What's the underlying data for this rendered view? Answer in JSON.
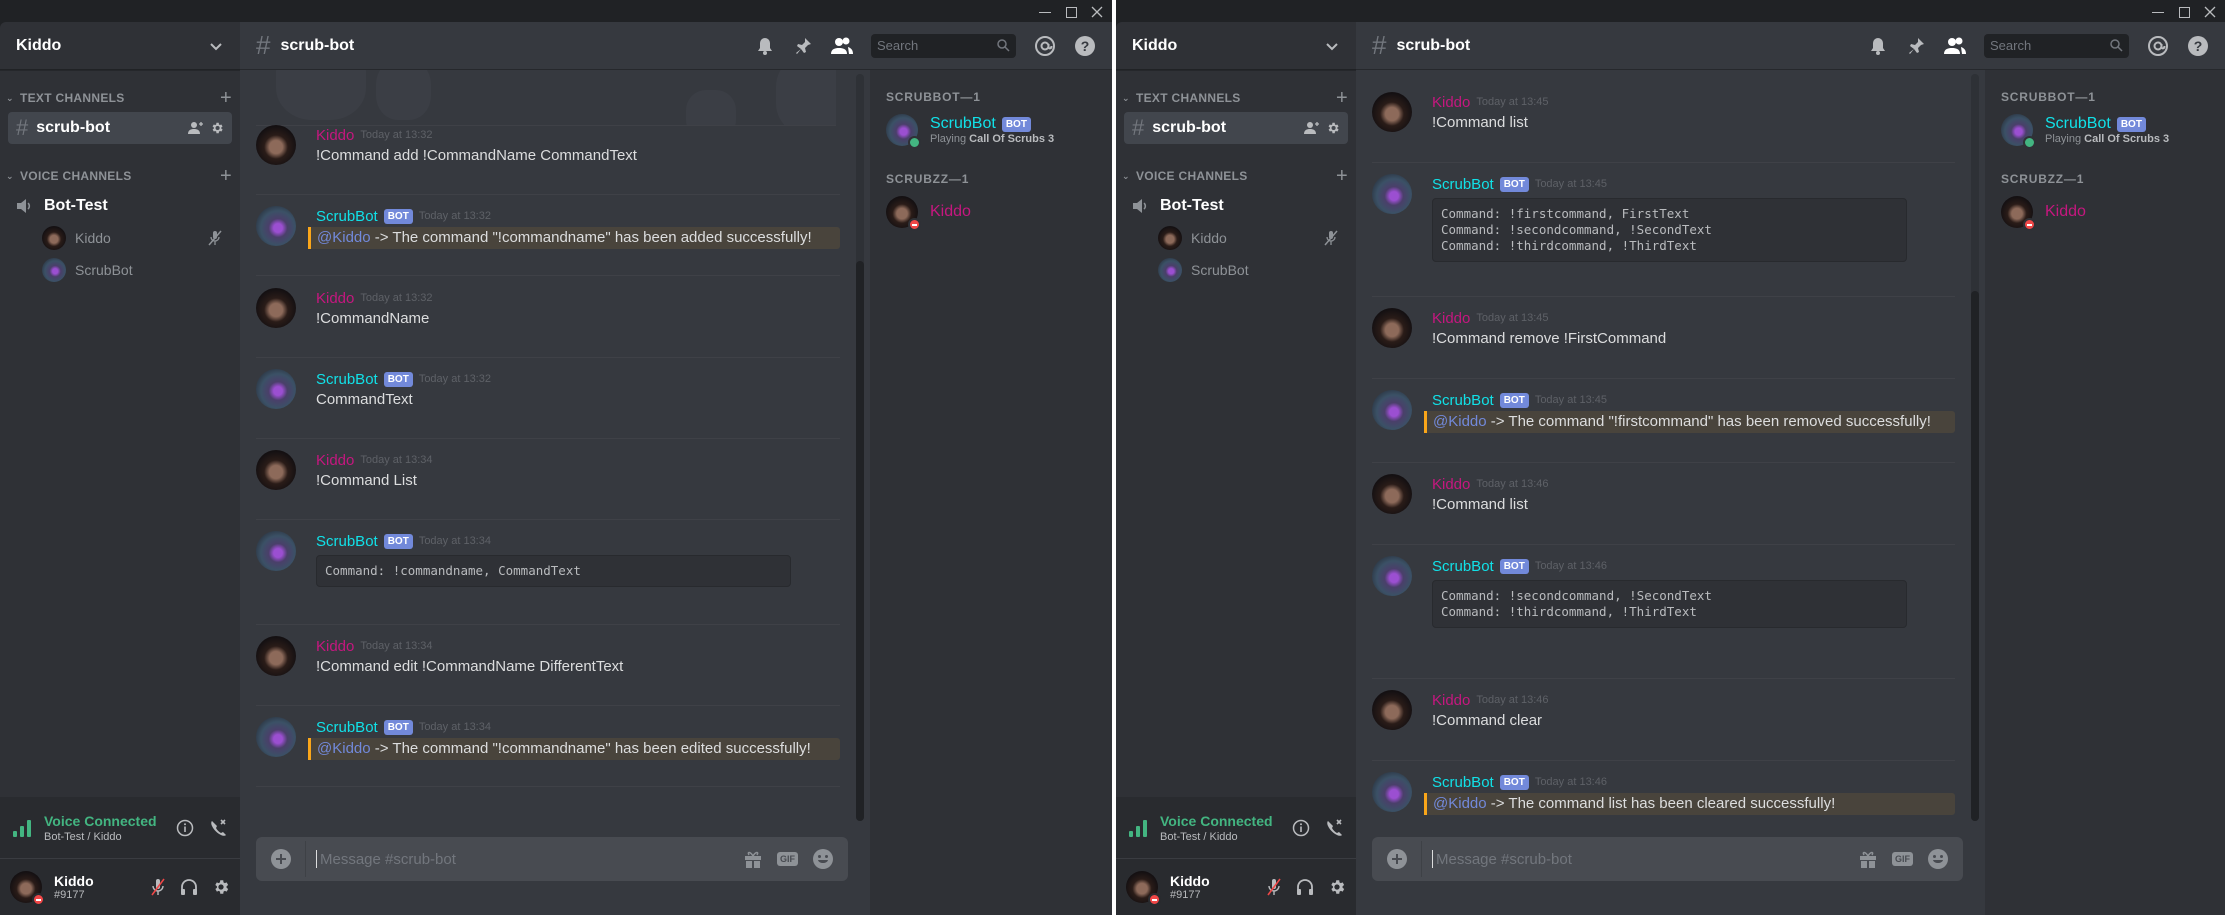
{
  "windows": [
    {
      "server_name": "Kiddo",
      "channel_header": "scrub-bot",
      "search_placeholder": "Search",
      "sidebar": {
        "text_category": "TEXT CHANNELS",
        "text_channel": "scrub-bot",
        "voice_category": "VOICE CHANNELS",
        "voice_channel": "Bot-Test",
        "voice_users": [
          "Kiddo",
          "ScrubBot"
        ]
      },
      "voice_panel": {
        "status": "Voice Connected",
        "location": "Bot-Test / Kiddo"
      },
      "user_panel": {
        "username": "Kiddo",
        "discriminator": "#9177"
      },
      "input_placeholder": "Message #scrub-bot",
      "gif_label": "GIF",
      "members": {
        "groups": [
          {
            "label": "SCRUBBOT—1",
            "name": "ScrubBot",
            "badge": "BOT",
            "activity_prefix": "Playing",
            "activity": "Call Of Scrubs 3"
          },
          {
            "label": "SCRUBZZ—1",
            "name": "Kiddo"
          }
        ]
      },
      "messages": [
        {
          "author": "Kiddo",
          "type": "user",
          "time": "Today at 13:32",
          "text": "!Command add !CommandName CommandText"
        },
        {
          "author": "ScrubBot",
          "type": "bot",
          "badge": "BOT",
          "time": "Today at 13:32",
          "mention": "@Kiddo",
          "text": " -> The command \"!commandname\" has been added successfully!"
        },
        {
          "author": "Kiddo",
          "type": "user",
          "time": "Today at 13:32",
          "text": "!CommandName"
        },
        {
          "author": "ScrubBot",
          "type": "bot",
          "badge": "BOT",
          "time": "Today at 13:32",
          "text": "CommandText"
        },
        {
          "author": "Kiddo",
          "type": "user",
          "time": "Today at 13:34",
          "text": "!Command List"
        },
        {
          "author": "ScrubBot",
          "type": "bot",
          "badge": "BOT",
          "time": "Today at 13:34",
          "code": "Command: !commandname, CommandText"
        },
        {
          "author": "Kiddo",
          "type": "user",
          "time": "Today at 13:34",
          "text": "!Command edit !CommandName DifferentText"
        },
        {
          "author": "ScrubBot",
          "type": "bot",
          "badge": "BOT",
          "time": "Today at 13:34",
          "mention": "@Kiddo",
          "text": " -> The command \"!commandname\" has been edited successfully!"
        }
      ],
      "scroll_position": 0.82
    },
    {
      "server_name": "Kiddo",
      "channel_header": "scrub-bot",
      "search_placeholder": "Search",
      "sidebar": {
        "text_category": "TEXT CHANNELS",
        "text_channel": "scrub-bot",
        "voice_category": "VOICE CHANNELS",
        "voice_channel": "Bot-Test",
        "voice_users": [
          "Kiddo",
          "ScrubBot"
        ]
      },
      "voice_panel": {
        "status": "Voice Connected",
        "location": "Bot-Test / Kiddo"
      },
      "user_panel": {
        "username": "Kiddo",
        "discriminator": "#9177"
      },
      "input_placeholder": "Message #scrub-bot",
      "gif_label": "GIF",
      "members": {
        "groups": [
          {
            "label": "SCRUBBOT—1",
            "name": "ScrubBot",
            "badge": "BOT",
            "activity_prefix": "Playing",
            "activity": "Call Of Scrubs 3"
          },
          {
            "label": "SCRUBZZ—1",
            "name": "Kiddo"
          }
        ]
      },
      "messages": [
        {
          "author": "Kiddo",
          "type": "user",
          "time": "Today at 13:45",
          "text": "!Command list"
        },
        {
          "author": "ScrubBot",
          "type": "bot",
          "badge": "BOT",
          "time": "Today at 13:45",
          "code": "Command: !firstcommand, FirstText\nCommand: !secondcommand, !SecondText\nCommand: !thirdcommand, !ThirdText"
        },
        {
          "author": "Kiddo",
          "type": "user",
          "time": "Today at 13:45",
          "text": "!Command remove !FirstCommand"
        },
        {
          "author": "ScrubBot",
          "type": "bot",
          "badge": "BOT",
          "time": "Today at 13:45",
          "mention": "@Kiddo",
          "text": " -> The command \"!firstcommand\" has been removed successfully!"
        },
        {
          "author": "Kiddo",
          "type": "user",
          "time": "Today at 13:46",
          "text": "!Command list"
        },
        {
          "author": "ScrubBot",
          "type": "bot",
          "badge": "BOT",
          "time": "Today at 13:46",
          "code": "Command: !secondcommand, !SecondText\nCommand: !thirdcommand, !ThirdText"
        },
        {
          "author": "Kiddo",
          "type": "user",
          "time": "Today at 13:46",
          "text": "!Command clear"
        },
        {
          "author": "ScrubBot",
          "type": "bot",
          "badge": "BOT",
          "time": "Today at 13:46",
          "mention": "@Kiddo",
          "text": " -> The command list has been cleared successfully!"
        }
      ],
      "scroll_position": 1.0
    }
  ],
  "colors": {
    "user_name": "#c5177f",
    "bot_name": "#11e1e8",
    "bot_badge": "#7289da",
    "mention_highlight": "#faa61a",
    "voice_connected": "#43b581",
    "dnd_status": "#f04747",
    "online_status": "#43b581"
  },
  "icons": {
    "bell": "bell-icon",
    "pin": "pin-icon",
    "members": "members-icon",
    "mention": "at-icon",
    "help": "help-icon",
    "search": "search-icon",
    "gift": "gift-icon",
    "emoji": "emoji-icon"
  }
}
